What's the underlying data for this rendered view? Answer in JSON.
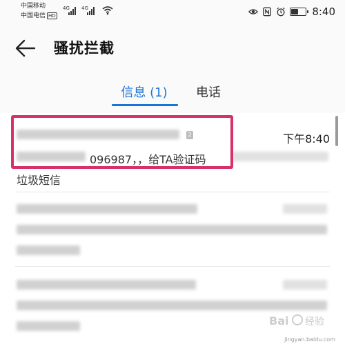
{
  "status_bar": {
    "carrier_1": "中国移动",
    "carrier_2": "中国电信",
    "hd_badge": "HD",
    "network_1": "4G",
    "network_2": "4G",
    "time": "8:40",
    "battery_level": 0.55,
    "icons": [
      "eye-icon",
      "nfc-icon",
      "alarm-icon",
      "battery-icon",
      "wifi-icon",
      "signal-icon"
    ]
  },
  "header": {
    "title": "骚扰拦截",
    "back_icon": "arrow-left-icon"
  },
  "tabs": [
    {
      "label": "信息 (1)",
      "active": true
    },
    {
      "label": "电话",
      "active": false
    }
  ],
  "messages": [
    {
      "time": "下午8:40",
      "sim_badge": "2",
      "preview_visible": "096987，，给TA验证码",
      "tag": "垃圾短信",
      "highlighted": true
    },
    {
      "time": "",
      "preview_visible": "",
      "tag": ""
    },
    {
      "time": "",
      "preview_visible": "",
      "tag": ""
    }
  ],
  "colors": {
    "accent": "#1a73d6",
    "highlight": "#d8306a"
  },
  "watermark": {
    "text": "jingyan.baidu.com"
  }
}
